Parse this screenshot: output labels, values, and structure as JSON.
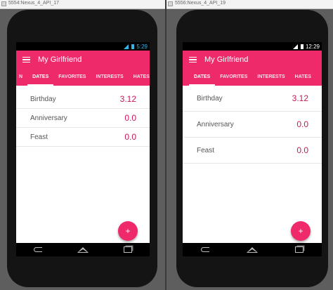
{
  "left": {
    "window_title": "5554:Nexus_4_API_17",
    "status_time": "5:29",
    "app_title": "My Girlfriend",
    "tabs": [
      "N",
      "DATES",
      "FAVORITES",
      "INTERESTS",
      "HATES"
    ],
    "rows": [
      {
        "label": "Birthday",
        "value": "3.12"
      },
      {
        "label": "Anniversary",
        "value": "0.0"
      },
      {
        "label": "Feast",
        "value": "0.0"
      }
    ],
    "fab_label": "+"
  },
  "right": {
    "window_title": "5556:Nexus_4_API_19",
    "status_time": "12:29",
    "app_title": "My Girlfriend",
    "tabs": [
      "DATES",
      "FAVORITES",
      "INTERESTS",
      "HATES"
    ],
    "rows": [
      {
        "label": "Birthday",
        "value": "3.12"
      },
      {
        "label": "Anniversary",
        "value": "0.0"
      },
      {
        "label": "Feast",
        "value": "0.0"
      }
    ],
    "fab_label": "+"
  },
  "colors": {
    "primary": "#ee2a6b",
    "value_text": "#c2185b",
    "status_left": "#33b5e5"
  }
}
